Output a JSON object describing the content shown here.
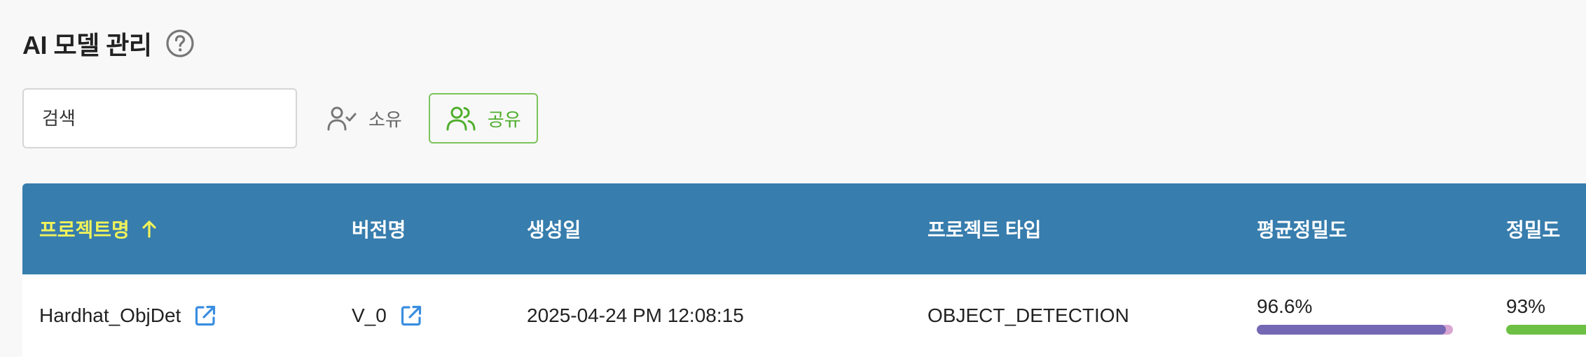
{
  "header": {
    "title": "AI 모델 관리"
  },
  "toolbar": {
    "search_placeholder": "검색",
    "filter_owned": "소유",
    "filter_shared": "공유"
  },
  "table": {
    "columns": [
      "프로젝트명",
      "버전명",
      "생성일",
      "프로젝트 타입",
      "평균정밀도",
      "정밀도"
    ],
    "rows": [
      {
        "project_name": "Hardhat_ObjDet",
        "version": "V_0",
        "created": "2025-04-24 PM 12:08:15",
        "project_type": "OBJECT_DETECTION",
        "avg_precision": "96.6%",
        "avg_precision_value": 0.966,
        "precision": "93%",
        "precision_value": 0.93
      }
    ]
  },
  "colors": {
    "header_bg": "#377dad",
    "sorted_header": "#f0f25a",
    "accent_green": "#7cc45c",
    "link_blue": "#3a8ee0",
    "avg_bar_fill": "#7468b4",
    "avg_bar_track": "#d8a6d3",
    "precision_bar_fill": "#6cc043"
  }
}
